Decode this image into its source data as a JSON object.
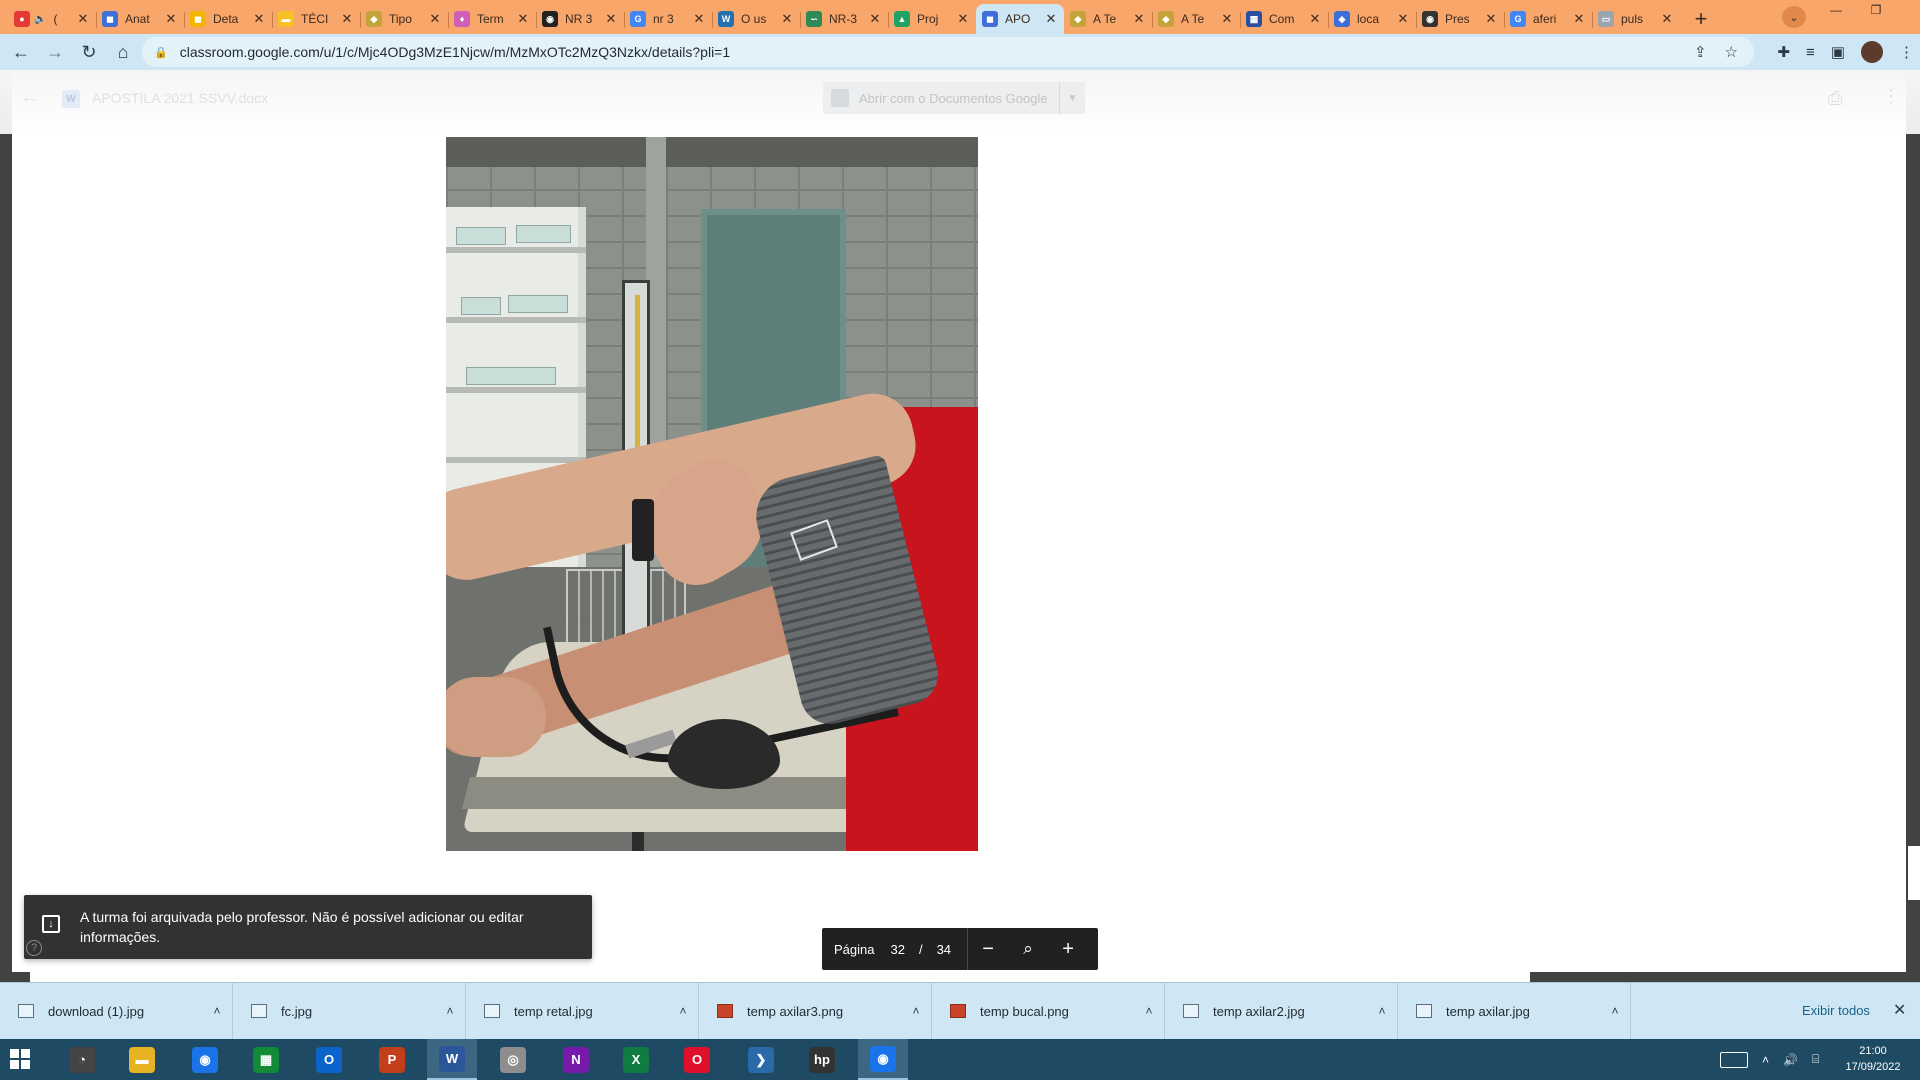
{
  "browser": {
    "tabs": [
      {
        "title": "(",
        "favicon_color": "#e53935",
        "favicon_glyph": "●",
        "audio": true
      },
      {
        "title": "Anat",
        "favicon_color": "#3f6fd8",
        "favicon_glyph": "◼"
      },
      {
        "title": "Deta",
        "favicon_color": "#f2b600",
        "favicon_glyph": "◼"
      },
      {
        "title": "TÉCI",
        "favicon_color": "#f6c026",
        "favicon_glyph": "▬"
      },
      {
        "title": "Tipo",
        "favicon_color": "#c4a43a",
        "favicon_glyph": "◆"
      },
      {
        "title": "Term",
        "favicon_color": "#d05fb7",
        "favicon_glyph": "♦"
      },
      {
        "title": "NR 3",
        "favicon_color": "#222222",
        "favicon_glyph": "◉"
      },
      {
        "title": "nr 3",
        "favicon_color": "#4285f4",
        "favicon_glyph": "G"
      },
      {
        "title": "O us",
        "favicon_color": "#2271b1",
        "favicon_glyph": "W"
      },
      {
        "title": "NR-3",
        "favicon_color": "#2e8b57",
        "favicon_glyph": "∽"
      },
      {
        "title": "Proj",
        "favicon_color": "#1fa463",
        "favicon_glyph": "▲"
      },
      {
        "title": "APO",
        "favicon_color": "#3f6fd8",
        "favicon_glyph": "◼",
        "active": true
      },
      {
        "title": "A Te",
        "favicon_color": "#c4a43a",
        "favicon_glyph": "◆"
      },
      {
        "title": "A Te",
        "favicon_color": "#c4a43a",
        "favicon_glyph": "◆"
      },
      {
        "title": "Com",
        "favicon_color": "#2a4fa0",
        "favicon_glyph": "▦"
      },
      {
        "title": "loca",
        "favicon_color": "#3b6ed6",
        "favicon_glyph": "◈"
      },
      {
        "title": "Pres",
        "favicon_color": "#333333",
        "favicon_glyph": "◉"
      },
      {
        "title": "aferi",
        "favicon_color": "#4285f4",
        "favicon_glyph": "G"
      },
      {
        "title": "puls",
        "favicon_color": "#9aa5ad",
        "favicon_glyph": "▭"
      }
    ],
    "url": "classroom.google.com/u/1/c/Mjc4ODg3MzE1Njcw/m/MzMxOTc2MzQ3Nzkx/details?pli=1"
  },
  "viewer": {
    "file_name": "APOSTILA 2021 SSVV.docx",
    "open_with_label": "Abrir com o Documentos Google",
    "snackbar_message": "A turma foi arquivada pelo professor. Não é possível adicionar ou editar informações.",
    "page_label": "Página",
    "current_page": "32",
    "page_separator": "/",
    "total_pages": "34"
  },
  "downloads": {
    "items": [
      {
        "name": "download (1).jpg",
        "type": "image"
      },
      {
        "name": "fc.jpg",
        "type": "image"
      },
      {
        "name": "temp retal.jpg",
        "type": "image"
      },
      {
        "name": "temp axilar3.png",
        "type": "ppt"
      },
      {
        "name": "temp bucal.png",
        "type": "ppt"
      },
      {
        "name": "temp axilar2.jpg",
        "type": "image"
      },
      {
        "name": "temp axilar.jpg",
        "type": "image"
      }
    ],
    "show_all_label": "Exibir todos"
  },
  "taskbar": {
    "apps": [
      {
        "name": "media-player",
        "color": "#444444",
        "glyph": "◔"
      },
      {
        "name": "file-explorer",
        "color": "#e6b422",
        "glyph": "▬"
      },
      {
        "name": "chrome",
        "color": "#1a73e8",
        "glyph": "◉"
      },
      {
        "name": "excel-green",
        "color": "#138a36",
        "glyph": "▦"
      },
      {
        "name": "outlook",
        "color": "#0a64c9",
        "glyph": "O"
      },
      {
        "name": "powerpoint",
        "color": "#c43e1c",
        "glyph": "P"
      },
      {
        "name": "word",
        "color": "#2b579a",
        "glyph": "W",
        "active": true
      },
      {
        "name": "media",
        "color": "#8e8e8e",
        "glyph": "◎"
      },
      {
        "name": "onenote",
        "color": "#7719aa",
        "glyph": "N"
      },
      {
        "name": "excel",
        "color": "#107c41",
        "glyph": "X"
      },
      {
        "name": "opera",
        "color": "#e0102a",
        "glyph": "O"
      },
      {
        "name": "powershell",
        "color": "#2b6aa8",
        "glyph": "❯"
      },
      {
        "name": "hp",
        "color": "#333333",
        "glyph": "hp"
      },
      {
        "name": "chrome-active",
        "color": "#1a73e8",
        "glyph": "◉",
        "active": true
      }
    ],
    "time": "21:00",
    "date": "17/09/2022"
  }
}
